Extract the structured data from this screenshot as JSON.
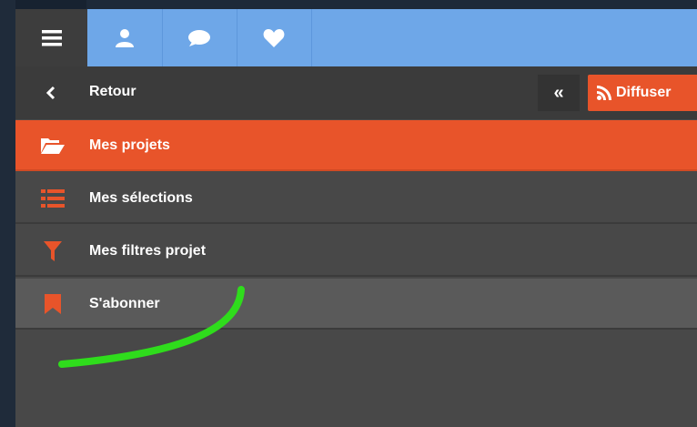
{
  "topbar": {
    "menu_icon": "hamburger-icon",
    "icons": [
      "user-icon",
      "chat-icon",
      "heart-icon"
    ],
    "accent_color": "#6ea7e8"
  },
  "header": {
    "back_label": "Retour",
    "collapse_label": "«",
    "diffuser_label": "Diffuser"
  },
  "menu": {
    "items": [
      {
        "label": "Mes projets",
        "icon": "folder-open-icon",
        "active": true
      },
      {
        "label": "Mes sélections",
        "icon": "list-icon",
        "active": false
      },
      {
        "label": "Mes filtres projet",
        "icon": "filter-icon",
        "active": false
      },
      {
        "label": "S'abonner",
        "icon": "bookmark-icon",
        "active": false
      }
    ]
  },
  "colors": {
    "brand_orange": "#e8542a",
    "panel": "#484848",
    "annotation_green": "#2fdc1c"
  }
}
